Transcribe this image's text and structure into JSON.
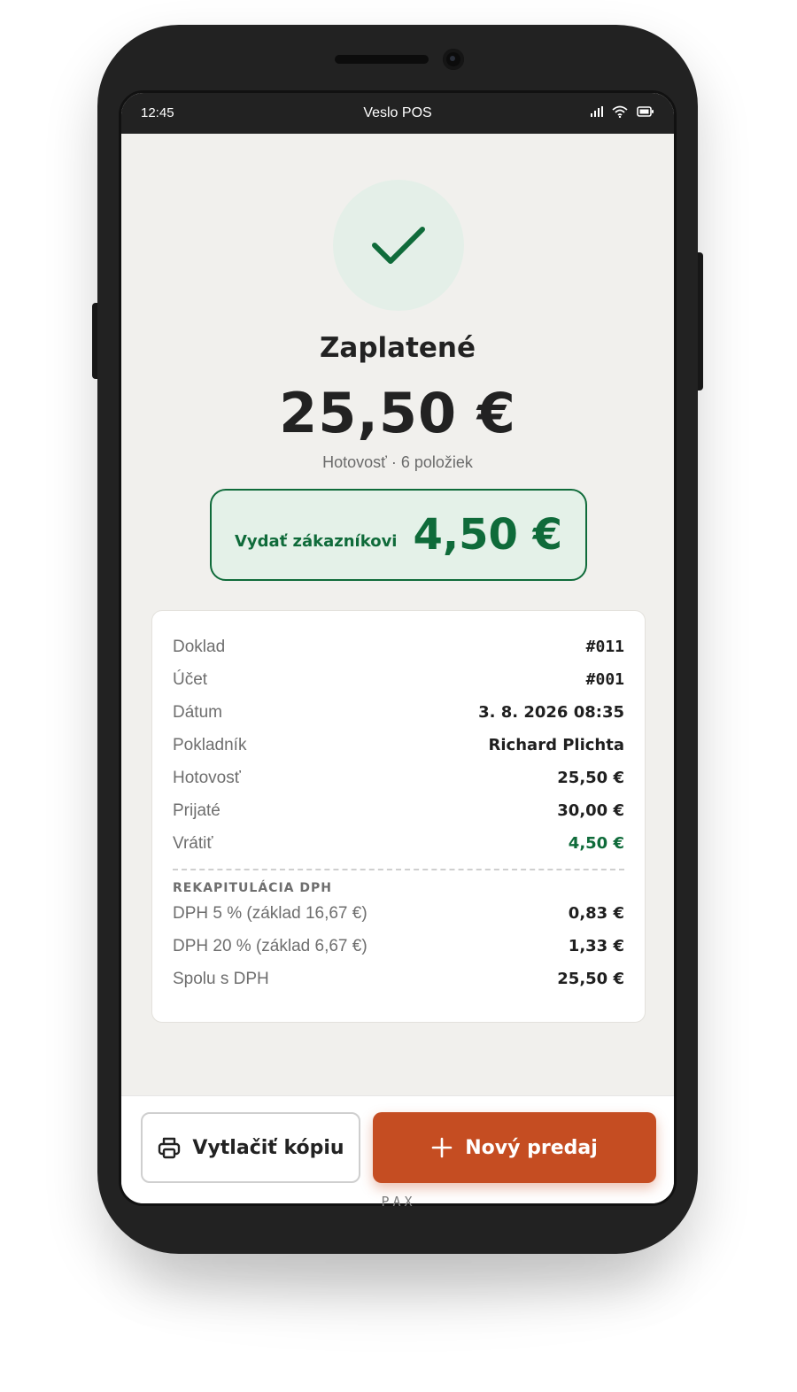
{
  "status_bar": {
    "time": "12:45",
    "app_title": "Veslo POS"
  },
  "payment": {
    "title": "Zaplatené",
    "amount": "25,50 €",
    "subtitle": "Hotovosť · 6 položiek",
    "change_label": "Vydať zákazníkovi",
    "change_amount": "4,50 €"
  },
  "receipt": {
    "rows": [
      {
        "label": "Doklad",
        "value": "#011"
      },
      {
        "label": "Účet",
        "value": "#001"
      },
      {
        "label": "Dátum",
        "value": "3. 8. 2026 08:35"
      },
      {
        "label": "Pokladník",
        "value": "Richard Plichta"
      },
      {
        "label": "Hotovosť",
        "value": "25,50 €"
      },
      {
        "label": "Prijaté",
        "value": "30,00 €"
      },
      {
        "label": "Vrátiť",
        "value": "4,50 €"
      }
    ],
    "vat_section_label": "REKAPITULÁCIA DPH",
    "vat_rows": [
      {
        "label": "DPH 5 % (základ 16,67 €)",
        "value": "0,83 €"
      },
      {
        "label": "DPH 20 % (základ 6,67 €)",
        "value": "1,33 €"
      },
      {
        "label": "Spolu s DPH",
        "value": "25,50 €"
      }
    ]
  },
  "actions": {
    "print_label": "Vytlačiť kópiu",
    "new_sale_label": "Nový predaj"
  },
  "device_brand": "PAX",
  "colors": {
    "accent": "#c54d22",
    "success": "#0f6b3a",
    "success_bg": "#e4f1e8",
    "screen_bg": "#f1f0ed"
  }
}
